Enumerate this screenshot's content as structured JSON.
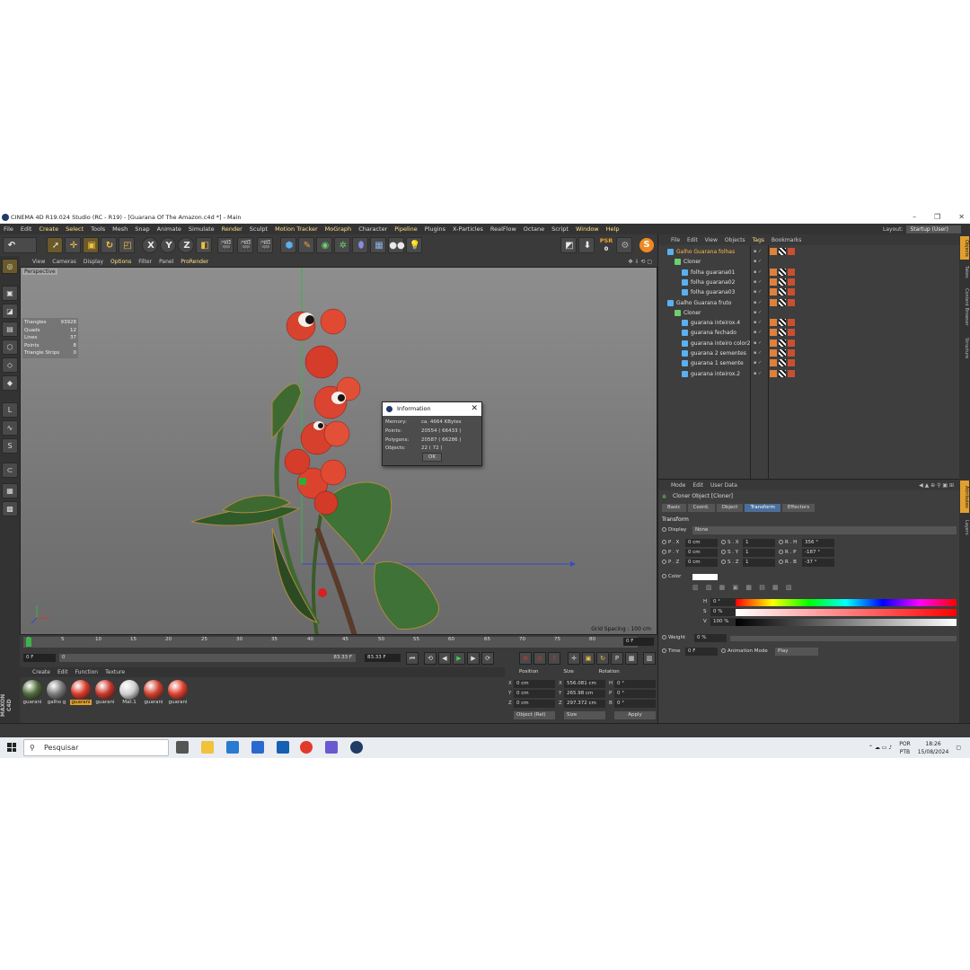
{
  "window": {
    "title": "CINEMA 4D R19.024 Studio (RC - R19) - [Guarana Of The Amazon.c4d *] - Main",
    "controls": [
      "–",
      "❐",
      "✕"
    ]
  },
  "menu": [
    "File",
    "Edit",
    "Create",
    "Select",
    "Tools",
    "Mesh",
    "Snap",
    "Animate",
    "Simulate",
    "Render",
    "Sculpt",
    "Motion Tracker",
    "MoGraph",
    "Character",
    "Pipeline",
    "Plugins",
    "X-Particles",
    "RealFlow",
    "Octane",
    "Script",
    "Window",
    "Help"
  ],
  "layout": {
    "label": "Layout:",
    "value": "Startup (User)"
  },
  "toolbar": {
    "axis_x": "X",
    "axis_y": "Y",
    "axis_z": "Z",
    "psr_label": "PSR",
    "psr_value": "0",
    "s_badge": "S"
  },
  "viewport": {
    "menu": [
      "View",
      "Cameras",
      "Display",
      "Options",
      "Filter",
      "Panel",
      "ProRender"
    ],
    "label": "Perspective",
    "stats": [
      {
        "k": "Triangles",
        "v": "93928"
      },
      {
        "k": "Quads",
        "v": "12"
      },
      {
        "k": "Lines",
        "v": "37"
      },
      {
        "k": "Points",
        "v": "8"
      },
      {
        "k": "Triangle Strips",
        "v": "0"
      }
    ],
    "grid_spacing": "Grid Spacing : 100 cm"
  },
  "info_dialog": {
    "title": "Information",
    "rows": [
      {
        "k": "Memory:",
        "v": "ca. 4664 KBytes"
      },
      {
        "k": "Points:",
        "v": "20554 ( 66433 )"
      },
      {
        "k": "Polygons:",
        "v": "20587 ( 66286 )"
      },
      {
        "k": "Objects:",
        "v": "22 ( 72 )"
      }
    ],
    "ok": "OK"
  },
  "timeline": {
    "ticks": [
      "0",
      "5",
      "10",
      "15",
      "20",
      "25",
      "30",
      "35",
      "40",
      "45",
      "50",
      "55",
      "60",
      "65",
      "70",
      "75",
      "80"
    ],
    "current_frame": "0 F",
    "start": "0 F",
    "min": "0",
    "end_a": "83.33 F",
    "end_b": "83.33 F"
  },
  "materials": {
    "menu": [
      "Create",
      "Edit",
      "Function",
      "Texture"
    ],
    "items": [
      "guarani",
      "galho g",
      "guarani",
      "guarani",
      "Mat.1",
      "guarani",
      "guarani"
    ],
    "selected_index": 2,
    "colors": [
      "#4f6b3a",
      "#7a7a7a",
      "#d83a2a",
      "#c9362a",
      "#cfcfcf",
      "#d0402c",
      "#e04030"
    ]
  },
  "coords": {
    "headers": [
      "Position",
      "Size",
      "Rotation"
    ],
    "px": "0 cm",
    "py": "0 cm",
    "pz": "0 cm",
    "sx": "556.081 cm",
    "sy": "265.98 cm",
    "sz": "297.372 cm",
    "rh": "0 °",
    "rp": "0 °",
    "rb": "0 °",
    "mode_a": "Object (Rel)",
    "mode_b": "Size",
    "apply": "Apply"
  },
  "objects": {
    "menu": [
      "File",
      "Edit",
      "View",
      "Objects",
      "Tags",
      "Bookmarks"
    ],
    "rows": [
      {
        "name": "Galho Guarana folhas",
        "depth": 0,
        "hl": true
      },
      {
        "name": "Cloner",
        "depth": 1,
        "hl": false
      },
      {
        "name": "folha guarana01",
        "depth": 2,
        "hl": false
      },
      {
        "name": "folha guarana02",
        "depth": 2,
        "hl": false
      },
      {
        "name": "folha guarana03",
        "depth": 2,
        "hl": false
      },
      {
        "name": "Galho Guarana fruto",
        "depth": 0,
        "hl": false
      },
      {
        "name": "Cloner",
        "depth": 1,
        "hl": false
      },
      {
        "name": "guarana inteirox.4",
        "depth": 2,
        "hl": false
      },
      {
        "name": "guarana fechado",
        "depth": 2,
        "hl": false
      },
      {
        "name": "guarana inteiro color2",
        "depth": 2,
        "hl": false
      },
      {
        "name": "guarana 2 sementes",
        "depth": 2,
        "hl": false
      },
      {
        "name": "guarana 1 semente",
        "depth": 2,
        "hl": false
      },
      {
        "name": "guarana inteirox.2",
        "depth": 2,
        "hl": false
      }
    ]
  },
  "attributes": {
    "menu": [
      "Mode",
      "Edit",
      "User Data"
    ],
    "title": "Cloner Object [Cloner]",
    "tabs": [
      "Basic",
      "Coord.",
      "Object",
      "Transform",
      "Effectors"
    ],
    "active_tab": "Transform",
    "section": "Transform",
    "display_label": "Display",
    "display_value": "None",
    "px": "0 cm",
    "py": "0 cm",
    "pz": "0 cm",
    "sx": "1",
    "sy": "1",
    "sz": "1",
    "rh": "356 °",
    "rp": "-187 °",
    "rb": "-37 °",
    "color_label": "Color",
    "h_label": "H",
    "h_value": "0 °",
    "s_label": "S",
    "s_value": "0 %",
    "v_label": "V",
    "v_value": "100 %",
    "weight_label": "Weight",
    "weight_value": "0 %",
    "time_label": "Time",
    "time_value": "0 F",
    "anim_label": "Animation Mode",
    "anim_value": "Play"
  },
  "right_tabs": [
    "Objects",
    "Takes",
    "Content Browser",
    "Structure",
    "Attributes",
    "Layers"
  ],
  "taskbar": {
    "search": "Pesquisar",
    "lang_a": "POR",
    "lang_b": "PTB",
    "time": "18:26",
    "date": "15/08/2024"
  }
}
